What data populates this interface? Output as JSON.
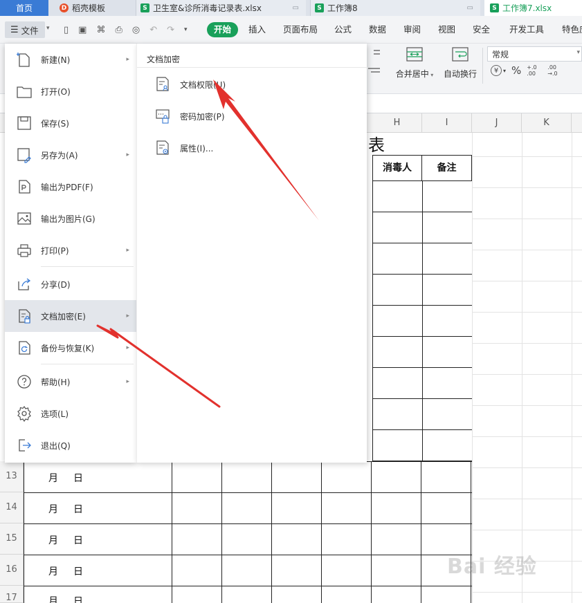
{
  "tabs": [
    {
      "label": "首页",
      "icon": "home"
    },
    {
      "label": "稻壳模板",
      "icon": "docer-icon"
    },
    {
      "label": "卫生室&诊所消毒记录表.xlsx",
      "icon": "sheet-icon"
    },
    {
      "label": "工作簿8",
      "icon": "sheet-icon"
    },
    {
      "label": "工作簿7.xlsx",
      "icon": "sheet-icon"
    }
  ],
  "toolbar": {
    "file_label": "文件",
    "menu_tabs": [
      "开始",
      "插入",
      "页面布局",
      "公式",
      "数据",
      "审阅",
      "视图",
      "安全",
      "开发工具",
      "特色应"
    ]
  },
  "ribbon": {
    "merge_label": "合并居中",
    "wrap_label": "自动换行",
    "number_format": "常规",
    "currency_symbol": "¥",
    "percent_symbol": "%",
    "dec_inc": "+.0 .00",
    "dec_dec": ".00 →.0"
  },
  "columns": [
    "H",
    "I",
    "J",
    "K"
  ],
  "sheet": {
    "title_fragment": "表",
    "header_disinfector": "消毒人",
    "header_remark": "备注",
    "row_numbers": [
      "13",
      "14",
      "15",
      "16",
      "17"
    ],
    "month": "月",
    "day": "日"
  },
  "file_menu": {
    "items": [
      {
        "label": "新建(N)",
        "icon": "new-file-icon",
        "arrow": true
      },
      {
        "label": "打开(O)",
        "icon": "open-folder-icon",
        "arrow": false
      },
      {
        "label": "保存(S)",
        "icon": "save-icon",
        "arrow": false
      },
      {
        "label": "另存为(A)",
        "icon": "save-as-icon",
        "arrow": true
      },
      {
        "label": "输出为PDF(F)",
        "icon": "pdf-icon",
        "arrow": false
      },
      {
        "label": "输出为图片(G)",
        "icon": "image-export-icon",
        "arrow": false
      },
      {
        "label": "打印(P)",
        "icon": "print-icon",
        "arrow": true
      },
      {
        "label": "分享(D)",
        "icon": "share-icon",
        "arrow": false
      },
      {
        "label": "文档加密(E)",
        "icon": "encrypt-doc-icon",
        "arrow": true
      },
      {
        "label": "备份与恢复(K)",
        "icon": "backup-icon",
        "arrow": true
      },
      {
        "label": "帮助(H)",
        "icon": "help-icon",
        "arrow": true
      },
      {
        "label": "选项(L)",
        "icon": "gear-icon",
        "arrow": false
      },
      {
        "label": "退出(Q)",
        "icon": "exit-icon",
        "arrow": false
      }
    ]
  },
  "submenu": {
    "title": "文档加密",
    "items": [
      {
        "label": "文档权限(U)",
        "icon": "doc-permission-icon"
      },
      {
        "label": "密码加密(P)",
        "icon": "password-lock-icon"
      },
      {
        "label": "属性(I)...",
        "icon": "properties-icon"
      }
    ]
  },
  "watermark": "Bai 经验",
  "colors": {
    "accent_green": "#19a05a",
    "arrow_red": "#e2312d",
    "tab_bar": "#dde2ea"
  }
}
